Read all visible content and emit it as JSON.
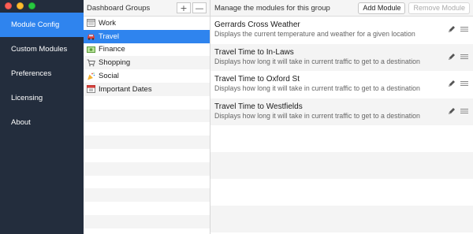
{
  "sidebar": {
    "items": [
      {
        "label": "Module Config",
        "active": true
      },
      {
        "label": "Custom Modules",
        "active": false
      },
      {
        "label": "Preferences",
        "active": false
      },
      {
        "label": "Licensing",
        "active": false
      },
      {
        "label": "About",
        "active": false
      }
    ]
  },
  "groups": {
    "title": "Dashboard Groups",
    "add_label": "+",
    "remove_label": "—",
    "items": [
      {
        "label": "Work",
        "icon": "calendar-icon",
        "active": false
      },
      {
        "label": "Travel",
        "icon": "car-icon",
        "active": true
      },
      {
        "label": "Finance",
        "icon": "money-icon",
        "active": false
      },
      {
        "label": "Shopping",
        "icon": "cart-icon",
        "active": false
      },
      {
        "label": "Social",
        "icon": "party-popper-icon",
        "active": false
      },
      {
        "label": "Important Dates",
        "icon": "date-calendar-icon",
        "active": false
      }
    ]
  },
  "modules": {
    "title": "Manage the modules for this group",
    "add_label": "Add Module",
    "remove_label": "Remove Module",
    "items": [
      {
        "name": "Gerrards Cross Weather",
        "description": "Displays the current temperature and weather for a given location"
      },
      {
        "name": "Travel Time to In-Laws",
        "description": "Displays how long it will take in current traffic to get to a destination"
      },
      {
        "name": "Travel Time to Oxford St",
        "description": "Displays how long it will take in current traffic to get to a destination"
      },
      {
        "name": "Travel Time to Westfields",
        "description": "Displays how long it will take in current traffic to get to a destination"
      }
    ]
  },
  "colors": {
    "sidebar_bg": "#232d3d",
    "accent": "#2f84ee"
  }
}
